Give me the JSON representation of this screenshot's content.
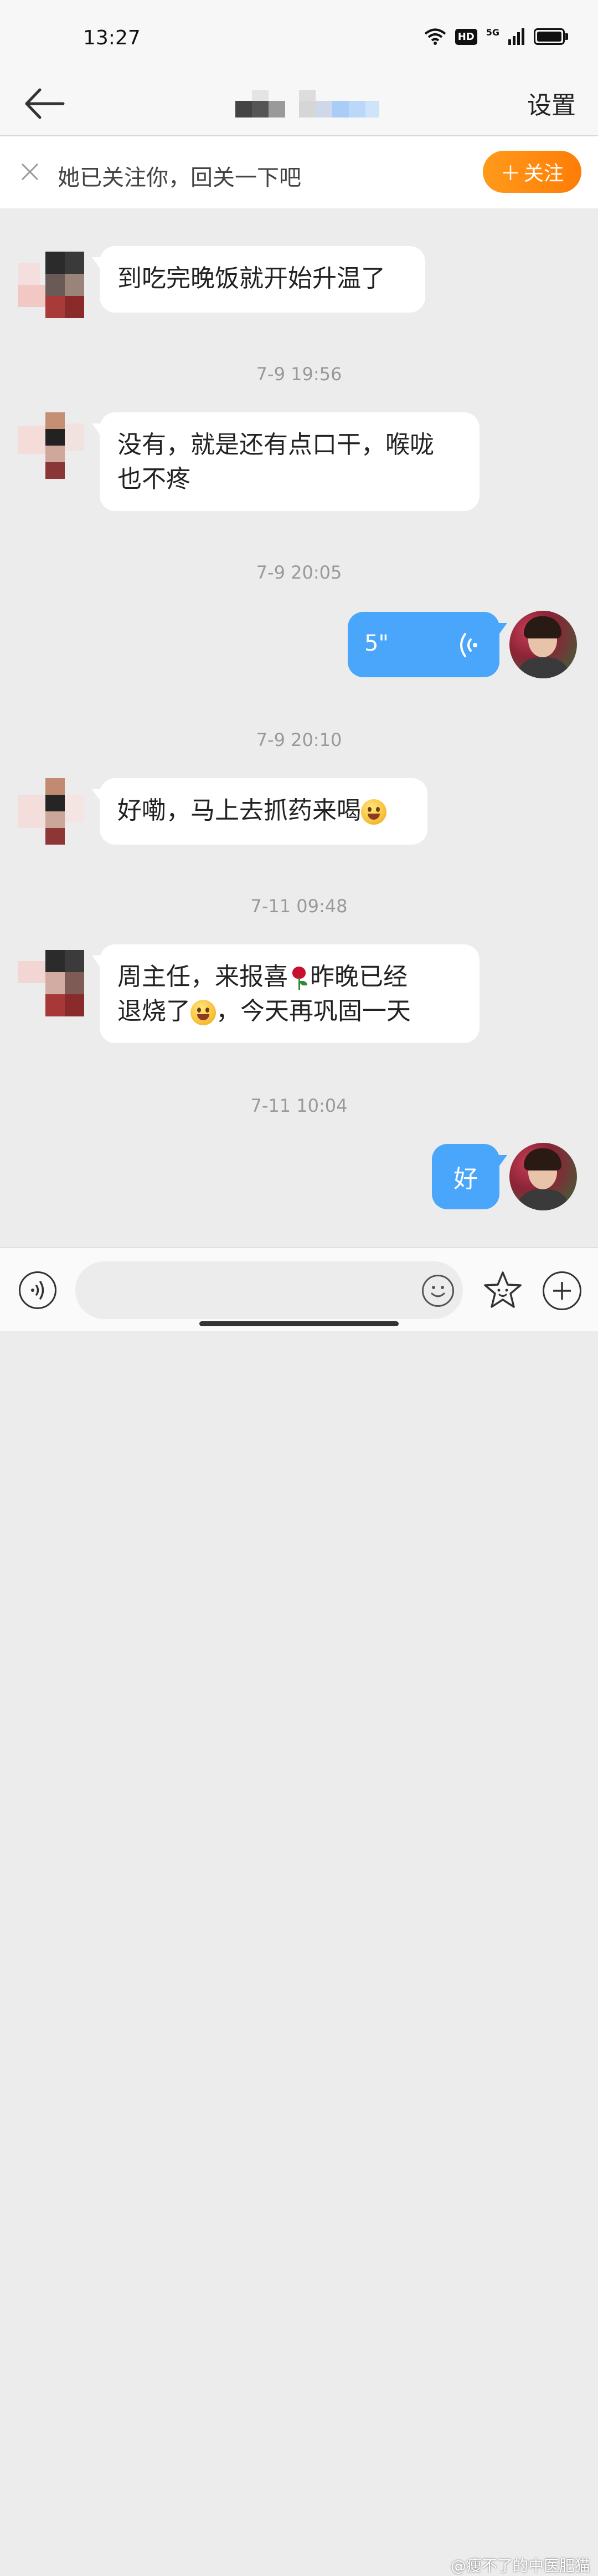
{
  "status_bar": {
    "time": "13:27",
    "hd_label": "HD",
    "network_label": "5G"
  },
  "nav": {
    "settings_label": "设置"
  },
  "follow_bar": {
    "text": "她已关注你，回关一下吧",
    "button_label": "关注",
    "button_plus": "＋"
  },
  "messages": [
    {
      "type": "text",
      "sender": "other",
      "text": "到吃完晚饭就开始升温了"
    },
    {
      "type": "timestamp",
      "text": "7-9 19:56"
    },
    {
      "type": "text",
      "sender": "other",
      "lines": [
        "没有，就是还有点口干，喉咙",
        "也不疼"
      ]
    },
    {
      "type": "timestamp",
      "text": "7-9 20:05"
    },
    {
      "type": "voice",
      "sender": "me",
      "duration": "5\""
    },
    {
      "type": "timestamp",
      "text": "7-9 20:10"
    },
    {
      "type": "text",
      "sender": "other",
      "text": "好嘞，马上去抓药来喝",
      "emoji": "smiling-heart-emoji"
    },
    {
      "type": "timestamp",
      "text": "7-11 09:48"
    },
    {
      "type": "text",
      "sender": "other",
      "line1_a": "周主任，来报喜",
      "line1_b": "昨晚已经",
      "line2_a": "退烧了",
      "line2_b": "，今天再巩固一天",
      "emoji1": "rose-emoji",
      "emoji2": "grin-emoji"
    },
    {
      "type": "timestamp",
      "text": "7-11 10:04"
    },
    {
      "type": "text",
      "sender": "me",
      "text": "好"
    }
  ],
  "watermark": "@瘦不了的中医肥猫",
  "colors": {
    "accent_blue": "#4aa6fb",
    "follow_orange": "#ff8a0f",
    "bubble_white": "#ffffff"
  }
}
